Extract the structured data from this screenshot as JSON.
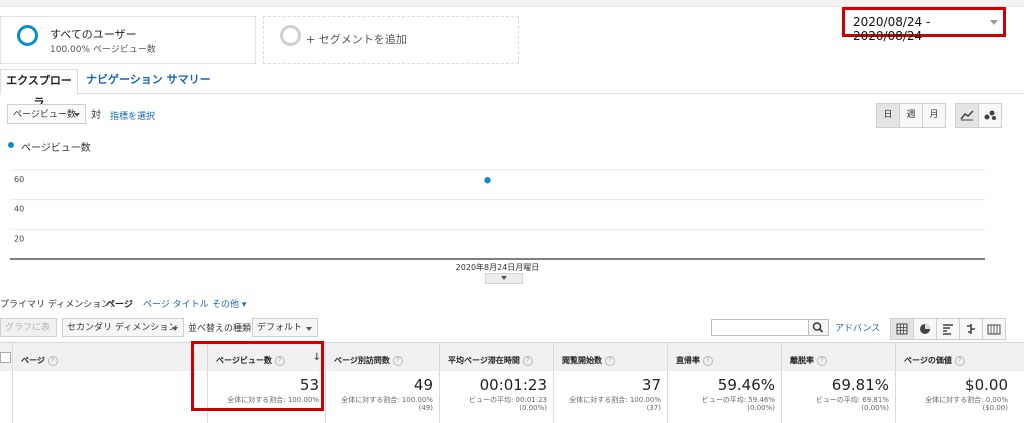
{
  "segments": {
    "active": {
      "title": "すべてのユーザー",
      "subtitle": "100.00% ページビュー数"
    },
    "add_label": "+ セグメントを追加"
  },
  "date_range": "2020/08/24 - 2020/08/24",
  "tabs": [
    {
      "label": "エクスプローラ",
      "active": true
    },
    {
      "label": "ナビゲーション サマリー",
      "active": false
    }
  ],
  "chart_controls": {
    "metric_select": "ページビュー数",
    "vs_label": "対",
    "select_metric_link": "指標を選択",
    "granularity": [
      {
        "label": "日",
        "selected": true
      },
      {
        "label": "週",
        "selected": false
      },
      {
        "label": "月",
        "selected": false
      }
    ],
    "chart_types": [
      "line-chart-icon",
      "motion-chart-icon"
    ]
  },
  "chart_data": {
    "type": "scatter",
    "series": [
      {
        "name": "ページビュー数",
        "color": "#0b8ec9",
        "values": [
          53
        ]
      }
    ],
    "categories": [
      "2020年8月24日月曜日"
    ],
    "yticks": [
      20,
      40,
      60
    ],
    "ylim": [
      0,
      70
    ],
    "grid": true
  },
  "dimension_bar": {
    "label": "プライマリ ディメンション:",
    "current": "ページ",
    "links": [
      "ページ タイトル",
      "その他 ▾"
    ]
  },
  "table_toolbar": {
    "graph_button": "グラフに表示",
    "secondary_dimension": "セカンダリ ディメンション",
    "sort_label": "並べ替えの種類:",
    "sort_value": "デフォルト",
    "search_placeholder": "",
    "advanced_link": "アドバンス",
    "view_icons": [
      "table-view-icon",
      "pie-view-icon",
      "performance-view-icon",
      "comparison-view-icon",
      "pivot-view-icon"
    ]
  },
  "table": {
    "columns": [
      {
        "label": "ページ"
      },
      {
        "label": "ページビュー数",
        "sorted": true
      },
      {
        "label": "ページ別訪問数"
      },
      {
        "label": "平均ページ滞在時間"
      },
      {
        "label": "閲覧開始数"
      },
      {
        "label": "直帰率"
      },
      {
        "label": "離脱率"
      },
      {
        "label": "ページの価値"
      }
    ],
    "totals": [
      {
        "value": "53",
        "sub1": "全体に対する割合: 100.00%",
        "sub2": ""
      },
      {
        "value": "49",
        "sub1": "全体に対する割合: 100.00%",
        "sub2": "(49)"
      },
      {
        "value": "00:01:23",
        "sub1": "ビューの平均: 00:01:23",
        "sub2": "(0.00%)"
      },
      {
        "value": "37",
        "sub1": "全体に対する割合: 100.00%",
        "sub2": "(37)"
      },
      {
        "value": "59.46%",
        "sub1": "ビューの平均: 59.46%",
        "sub2": "(0.00%)"
      },
      {
        "value": "69.81%",
        "sub1": "ビューの平均: 69.81%",
        "sub2": "(0.00%)"
      },
      {
        "value": "$0.00",
        "sub1": "全体に対する割合: 0.00%",
        "sub2": "($0.00)"
      }
    ]
  },
  "colors": {
    "accent": "#0b8ec9",
    "highlight": "#d10000",
    "link": "#1a66b3"
  }
}
